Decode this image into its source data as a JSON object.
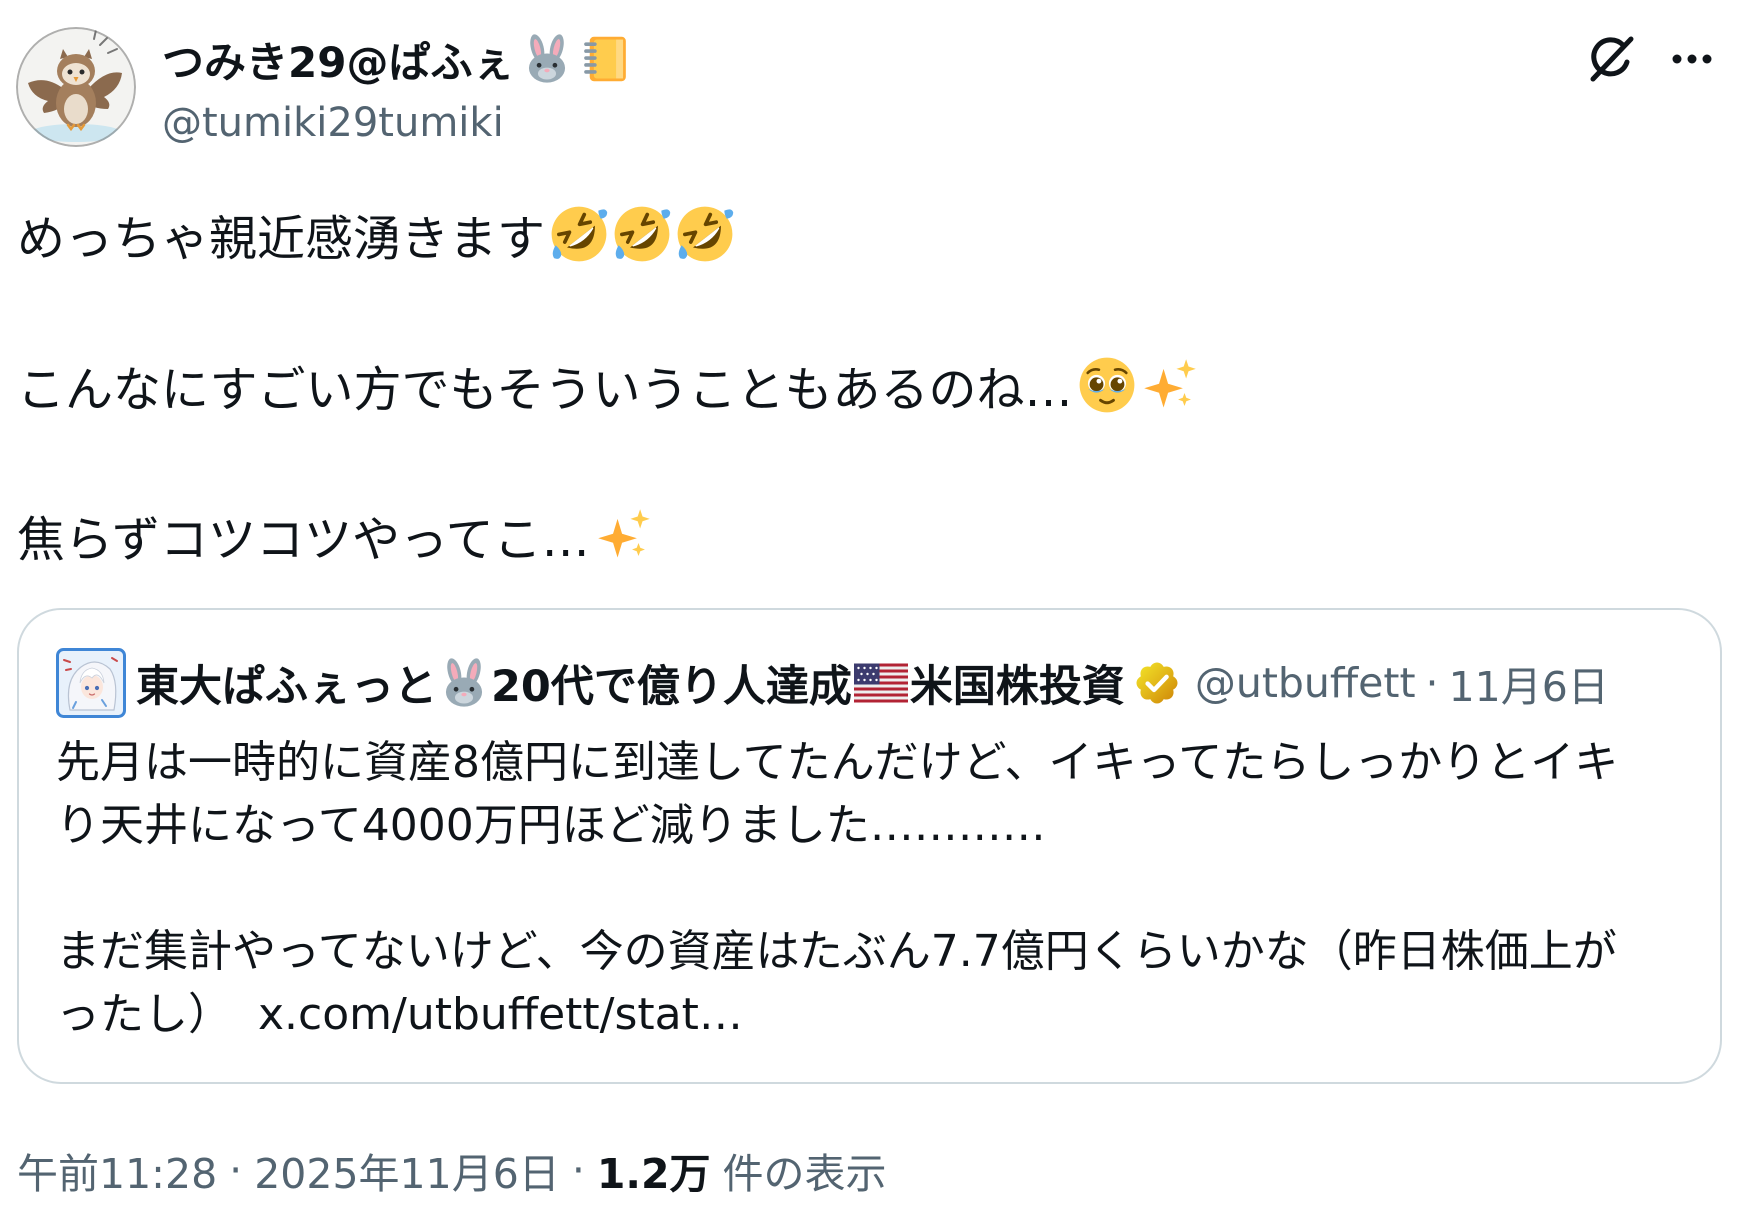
{
  "post": {
    "author": {
      "display_name": "つみき29@ぱふぇ",
      "name_emoji": [
        "rabbit-face-emoji",
        "ledger-emoji"
      ],
      "handle": "@tumiki29tumiki",
      "avatar_icon": "owl-avatar"
    },
    "header_actions": [
      "grok-icon",
      "more-icon"
    ],
    "body": [
      {
        "text": "めっちゃ親近感湧きます",
        "emoji": [
          "rolling-on-the-floor-laughing-emoji",
          "rolling-on-the-floor-laughing-emoji",
          "rolling-on-the-floor-laughing-emoji"
        ]
      },
      {
        "text": "こんなにすごい方でもそういうこともあるのね…",
        "emoji": [
          "face-holding-back-tears-emoji",
          "sparkles-emoji"
        ]
      },
      {
        "text": "焦らずコツコツやってこ…",
        "emoji": [
          "sparkles-emoji"
        ]
      }
    ],
    "quote": {
      "author": {
        "name_part_1": "東大ぱふぇっと",
        "name_part_2": "20代で億り人達成",
        "name_part_3": "米国株投資",
        "name_emoji": [
          "rabbit-face-emoji",
          "flag-united-states-emoji"
        ],
        "verified_badge": "gold-verified-badge-icon",
        "handle": "@utbuffett",
        "separator": "·",
        "date": "11月6日",
        "avatar_icon": "anime-character-avatar"
      },
      "paragraphs": [
        [
          "先月は一時的に資産8億円に到達してたんだけど、イキってたらしっかりとイキ",
          "り天井になって4000万円ほど減りました…………"
        ],
        [
          "まだ集計やってないけど、今の資産はたぶん7.7億円くらいかな（昨日株価上が",
          "ったし）"
        ]
      ],
      "link": "x.com/utbuffett/stat…"
    },
    "meta": {
      "time": "午前11:28",
      "separator": "·",
      "date": "2025年11月6日",
      "views_count": "1.2万",
      "views_label": "件の表示"
    }
  },
  "colors": {
    "text": "#0f1419",
    "secondary_text": "#536471",
    "card_border": "#cfd9de",
    "verified_gold": "#e2b719",
    "background": "#ffffff"
  }
}
